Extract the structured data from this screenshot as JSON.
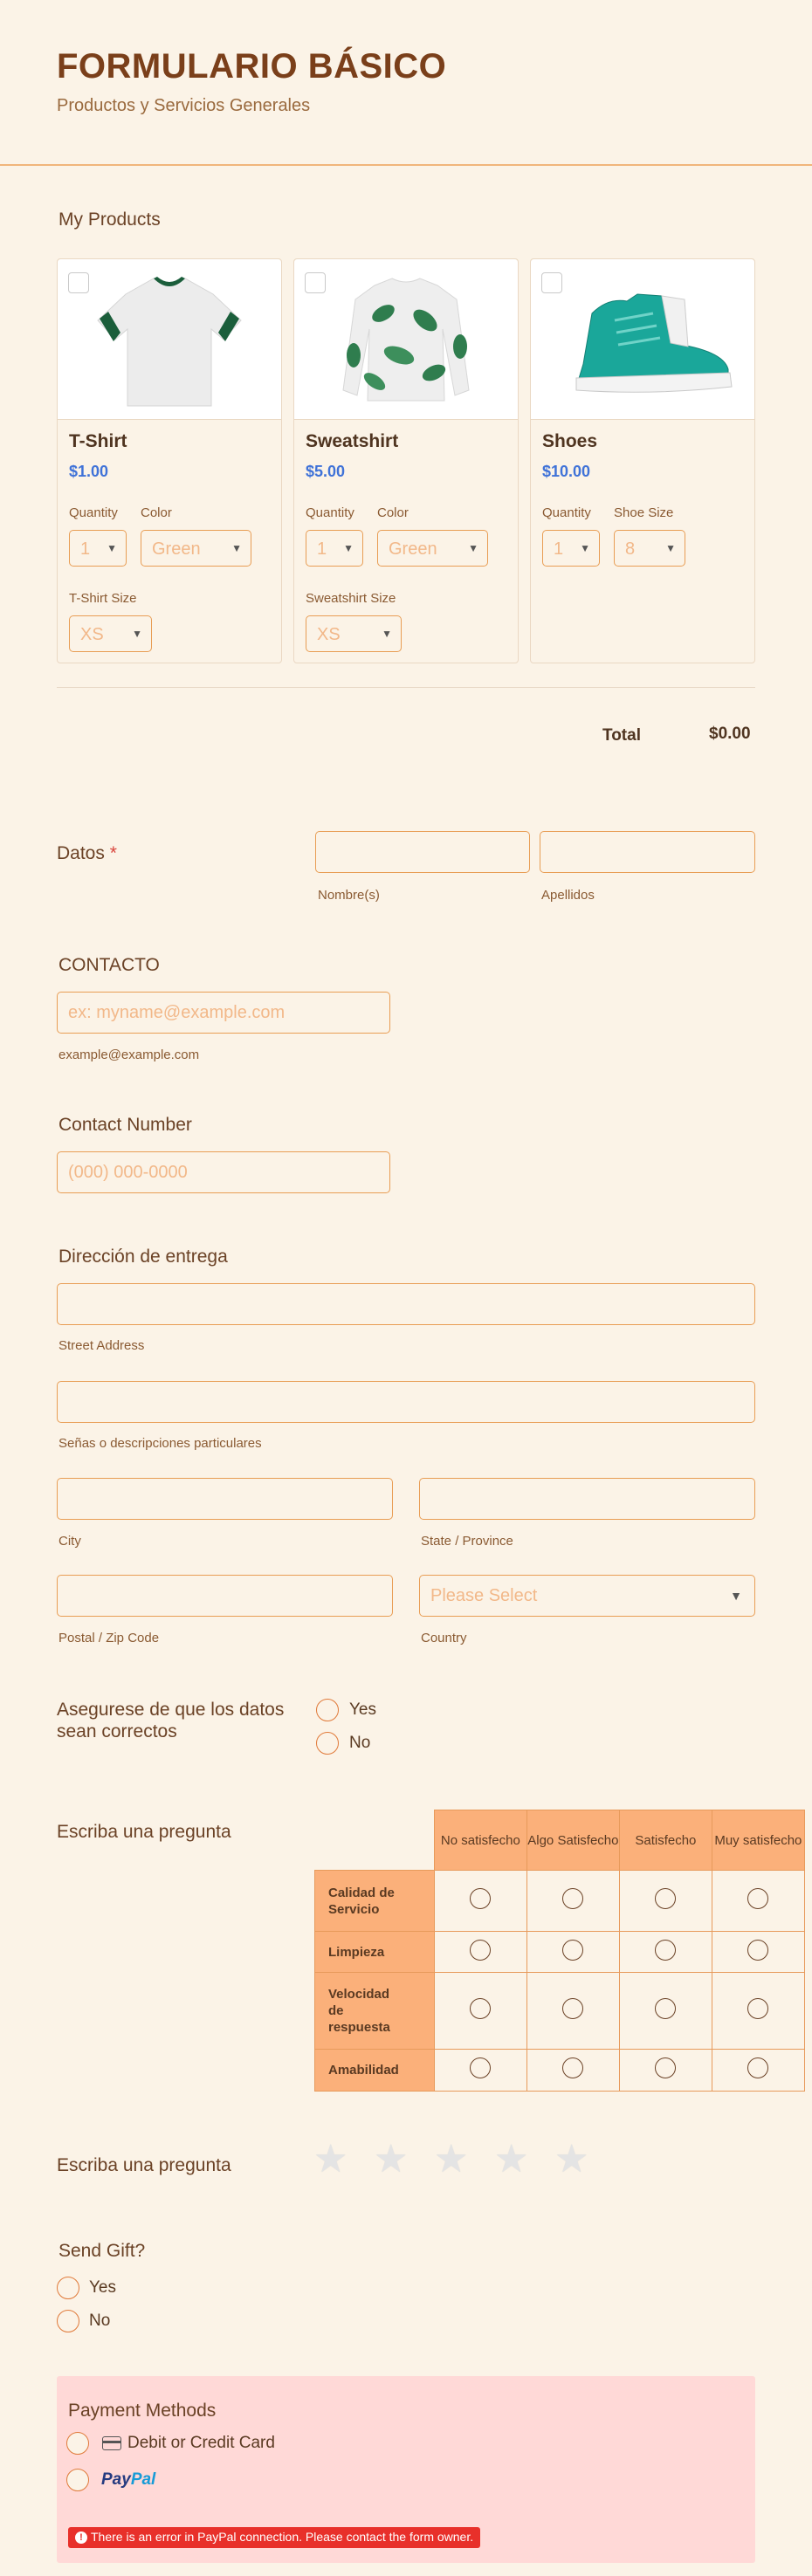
{
  "header": {
    "title": "FORMULARIO BÁSICO",
    "subtitle": "Productos y Servicios Generales"
  },
  "products": {
    "label": "My Products",
    "items": [
      {
        "name": "T-Shirt",
        "price": "$1.00",
        "quantity_label": "Quantity",
        "quantity_value": "1",
        "option_label": "Color",
        "option_value": "Green",
        "size_label": "T-Shirt Size",
        "size_value": "XS",
        "image_icon": "tshirt-image"
      },
      {
        "name": "Sweatshirt",
        "price": "$5.00",
        "quantity_label": "Quantity",
        "quantity_value": "1",
        "option_label": "Color",
        "option_value": "Green",
        "size_label": "Sweatshirt Size",
        "size_value": "XS",
        "image_icon": "sweatshirt-image"
      },
      {
        "name": "Shoes",
        "price": "$10.00",
        "quantity_label": "Quantity",
        "quantity_value": "1",
        "option_label": "Shoe Size",
        "option_value": "8",
        "image_icon": "shoes-image"
      }
    ],
    "total_label": "Total",
    "total_value": "$0.00"
  },
  "datos": {
    "label": "Datos",
    "required_mark": "*",
    "first_label": "Nombre(s)",
    "last_label": "Apellidos"
  },
  "contacto": {
    "label": "CONTACTO",
    "placeholder": "ex: myname@example.com",
    "sublabel": "example@example.com"
  },
  "phone": {
    "label": "Contact Number",
    "placeholder": "(000) 000-0000"
  },
  "address": {
    "label": "Dirección de entrega",
    "street_label": "Street Address",
    "line2_label": "Señas o descripciones particulares",
    "city_label": "City",
    "state_label": "State / Province",
    "zip_label": "Postal / Zip Code",
    "country_label": "Country",
    "country_placeholder": "Please Select"
  },
  "confirm": {
    "label": "Asegurese de que los datos sean correctos",
    "options": [
      "Yes",
      "No"
    ]
  },
  "matrix": {
    "label": "Escriba una pregunta",
    "columns": [
      "No satisfecho",
      "Algo Satisfecho",
      "Satisfecho",
      "Muy satisfecho"
    ],
    "rows": [
      "Calidad de Servicio",
      "Limpieza",
      "Velocidad de respuesta",
      "Amabilidad"
    ]
  },
  "rating": {
    "label": "Escriba una pregunta",
    "max": 5,
    "value": 0,
    "star_icon": "star-icon"
  },
  "gift": {
    "label": "Send Gift?",
    "options": [
      "Yes",
      "No"
    ]
  },
  "payment": {
    "label": "Payment Methods",
    "card_label": "Debit or Credit Card",
    "paypal_pay": "Pay",
    "paypal_pal": "Pal",
    "error": "There is an error in PayPal connection. Please contact the form owner.",
    "error_icon": "!",
    "colors": {
      "error": "#e8302a",
      "paypal_dark": "#253b80",
      "paypal_light": "#179bd7"
    }
  },
  "colors": {
    "background": "#fbf3e7",
    "accent": "#e89d54",
    "matrix_header": "#fbb07a",
    "price": "#3f72d8"
  }
}
